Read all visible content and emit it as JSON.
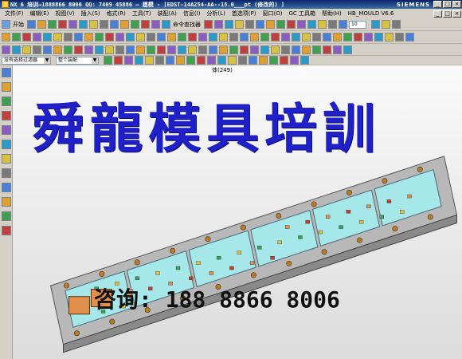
{
  "window": {
    "title": "NX 6 培训→1888866 8006 QQ: 7409 45886 — 建模 - [EDST-14A254-AA--15.0___pt (修改的) ]",
    "brand": "SIEMENS",
    "controls": [
      "_",
      "□",
      "×"
    ]
  },
  "menu": {
    "items": [
      "文件(F)",
      "编辑(E)",
      "视图(V)",
      "插入(S)",
      "格式(R)",
      "工具(T)",
      "装配(A)",
      "信息(I)",
      "分析(L)",
      "首选项(P)",
      "窗口(O)",
      "GC 工具箱",
      "帮助(H)",
      "HB_MOULD V6.6"
    ]
  },
  "toolbar": {
    "start_label": "开始",
    "command_finder": "命令查找器",
    "zoom_value": "10",
    "filter_placeholder": "没有选择过滤器",
    "assembly_scope": "整个装配",
    "tool_colors": [
      "#4a7fd8",
      "#e0a030",
      "#3fa050",
      "#c04040",
      "#8a5cc0",
      "#2a9ac8",
      "#d8c040",
      "#7a7a7a"
    ]
  },
  "viewport": {
    "part_count_label": "体(249)",
    "overlay_title": "舜龍模具培訓",
    "overlay_contact": "咨询: 188 8866 8006",
    "colors": {
      "plate": "#a6e8ea",
      "plate_edge": "#4a6a7a",
      "base": "#b8b8b8",
      "accent_orange": "#e0904a",
      "accent_green": "#3aa05a",
      "accent_red": "#c83a2a",
      "accent_yellow": "#e0c040",
      "pin": "#c07a20"
    }
  },
  "left_rail": {
    "icons": [
      "assembly-navigator-icon",
      "part-navigator-icon",
      "constraint-icon",
      "history-icon",
      "web-browser-icon",
      "roles-icon",
      "palette-icon",
      "system-materials-icon",
      "process-studio-icon",
      "reuse-library-icon",
      "manufacturing-wizard-icon",
      "hd3d-icon"
    ]
  }
}
